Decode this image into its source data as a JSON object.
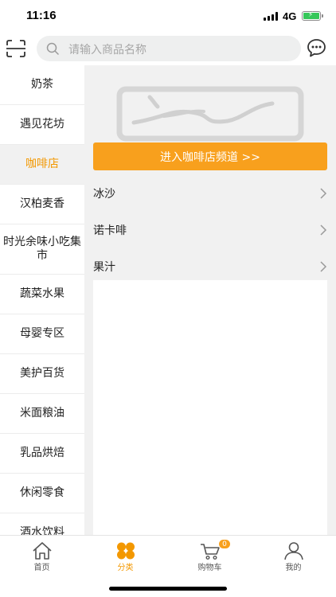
{
  "status_bar": {
    "time": "11:16",
    "network": "4G",
    "battery_charging": true,
    "battery_color": "#35c759"
  },
  "header": {
    "scan_icon": "scan-icon",
    "search": {
      "placeholder": "请输入商品名称",
      "value": ""
    },
    "chat_icon": "chat-bubble-icon"
  },
  "sidebar": {
    "items": [
      {
        "label": "奶茶",
        "active": false
      },
      {
        "label": "遇见花坊",
        "active": false
      },
      {
        "label": "咖啡店",
        "active": true
      },
      {
        "label": "汉柏麦香",
        "active": false
      },
      {
        "label": "时光余味小吃集市",
        "active": false
      },
      {
        "label": "蔬菜水果",
        "active": false
      },
      {
        "label": "母婴专区",
        "active": false
      },
      {
        "label": "美护百货",
        "active": false
      },
      {
        "label": "米面粮油",
        "active": false
      },
      {
        "label": "乳品烘焙",
        "active": false
      },
      {
        "label": "休闲零食",
        "active": false
      },
      {
        "label": "酒水饮料",
        "active": false
      }
    ]
  },
  "content": {
    "banner_icon": "image-placeholder-icon",
    "channel_button": "进入咖啡店频道 >>",
    "subcategories": [
      {
        "label": "冰沙"
      },
      {
        "label": "诺卡啡"
      },
      {
        "label": "果汁"
      }
    ]
  },
  "tabbar": {
    "tabs": [
      {
        "label": "首页",
        "icon": "home-icon",
        "active": false
      },
      {
        "label": "分类",
        "icon": "category-icon",
        "active": true
      },
      {
        "label": "购物车",
        "icon": "cart-icon",
        "active": false,
        "badge": "0"
      },
      {
        "label": "我的",
        "icon": "user-icon",
        "active": false
      }
    ]
  },
  "colors": {
    "accent": "#f39800",
    "button_orange": "#f8a01d",
    "content_bg": "#f1f1f1",
    "search_bg": "#eeefef"
  }
}
